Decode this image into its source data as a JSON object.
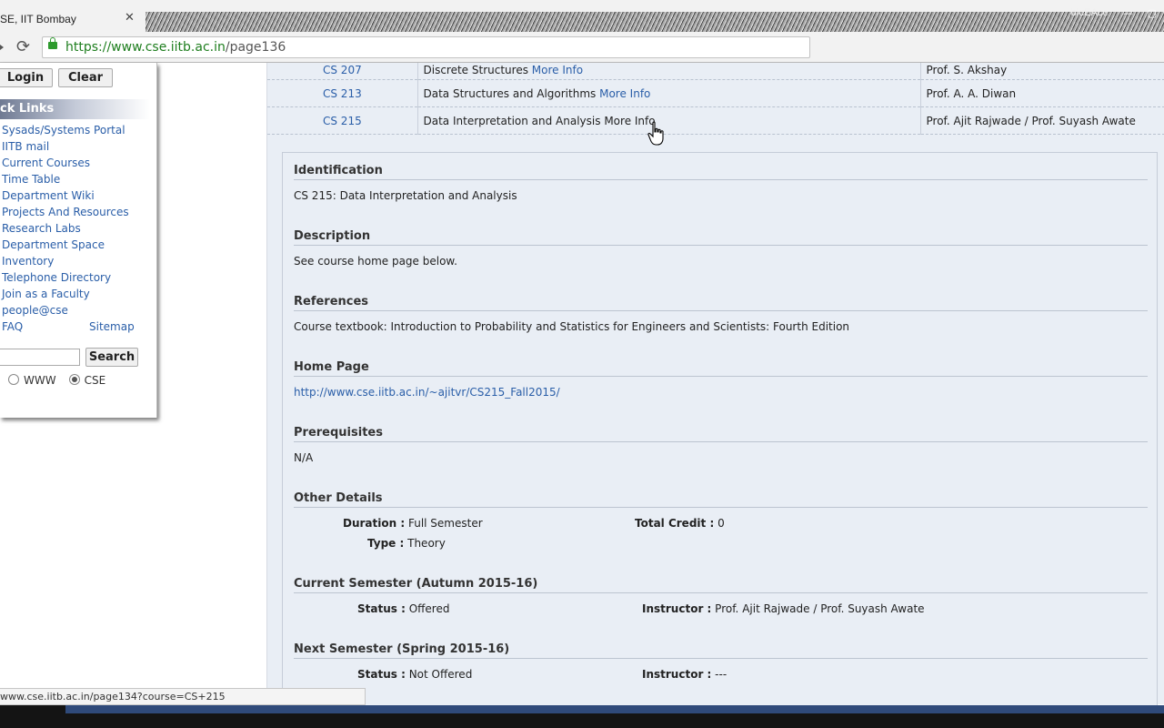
{
  "browser": {
    "tab_title": "SE, IIT Bombay",
    "tab_close": "✕",
    "window_user": "bluEAce",
    "url_domain": "https://www.cse.iitb.ac.in",
    "url_path": "/page136"
  },
  "sidebar": {
    "login_label": "Login",
    "clear_label": "Clear",
    "quick_links_title": "ck Links",
    "links": [
      "Sysads/Systems Portal",
      "IITB mail",
      "Current Courses",
      "Time Table",
      "Department Wiki",
      "Projects And Resources",
      "Research Labs",
      "Department Space",
      "Inventory",
      "Telephone Directory",
      "Join as a Faculty",
      "people@cse",
      "FAQ"
    ],
    "sitemap_label": "Sitemap",
    "search_label": "Search",
    "search_value": "",
    "radio_www": "WWW",
    "radio_cse": "CSE",
    "radio_selected": "CSE"
  },
  "courses": [
    {
      "code": "CS 207",
      "title": "Discrete Structures",
      "more": "More Info",
      "instructor": "Prof. S. Akshay"
    },
    {
      "code": "CS 213",
      "title": "Data Structures and Algorithms",
      "more": "More Info",
      "instructor": "Prof. A. A. Diwan"
    },
    {
      "code": "CS 215",
      "title": "Data Interpretation and Analysis",
      "more": "More Info",
      "instructor": "Prof. Ajit Rajwade / Prof. Suyash Awate"
    }
  ],
  "detail": {
    "identification_title": "Identification",
    "identification": "CS 215: Data Interpretation and Analysis",
    "description_title": "Description",
    "description": "See course home page below.",
    "references_title": "References",
    "references": "Course textbook: Introduction to Probability and Statistics for Engineers and Scientists: Fourth Edition",
    "homepage_title": "Home Page",
    "homepage": "http://www.cse.iitb.ac.in/~ajitvr/CS215_Fall2015/",
    "prereq_title": "Prerequisites",
    "prereq": "N/A",
    "other_title": "Other Details",
    "duration_key": "Duration :",
    "duration_val": "Full Semester",
    "credit_key": "Total Credit :",
    "credit_val": "0",
    "type_key": "Type :",
    "type_val": "Theory",
    "current_title": "Current Semester (Autumn 2015-16)",
    "current_status_key": "Status :",
    "current_status_val": "Offered",
    "current_instr_key": "Instructor :",
    "current_instr_val": "Prof. Ajit Rajwade / Prof. Suyash Awate",
    "next_title": "Next Semester (Spring 2015-16)",
    "next_status_key": "Status :",
    "next_status_val": "Not Offered",
    "next_instr_key": "Instructor :",
    "next_instr_val": "---"
  },
  "status_bar": "www.cse.iitb.ac.in/page134?course=CS+215",
  "colors": {
    "link": "#2a5ea8",
    "content_bg": "#e9eef5",
    "url_green": "#1e7e1e"
  }
}
